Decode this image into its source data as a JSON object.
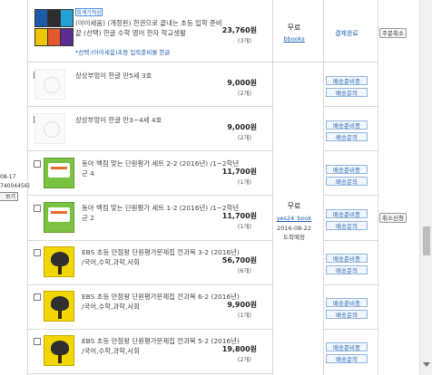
{
  "left_column": {
    "date_fragment": "08-17",
    "order_fragment": "74004456)",
    "button_fragment": "보기"
  },
  "products": [
    {
      "badge": "회계기혁상",
      "title": "(아이세움) (개정판) 한권으로 끝내는 초등 입학 준비 끝 (선택) 한글 수학 영어 한자 학교생활",
      "option": "*선택:(아이세움)초등 입학준비물 한글",
      "price": "23,760원",
      "qty": "(3개)"
    },
    {
      "title": "상상부엉이 한글 만5세 3호",
      "price": "9,000원",
      "qty": "(2개)"
    },
    {
      "title": "상상부엉이 한글 만3~4세 4호",
      "price": "9,000원",
      "qty": "(2개)"
    },
    {
      "title": "동아 백점 맞는 단원평가 세트 2-2 (2016년) /1~2학년군 4",
      "price": "11,700원",
      "qty": "(1개)"
    },
    {
      "title": "동아 백점 맞는 단원평가 세트 1-2 (2016년) /1~2학년군 2",
      "price": "11,700원",
      "qty": "(1개)"
    },
    {
      "title": "EBS 초등 만점왕 단원평가문제집 전과목 3-2 (2016년) /국어,수학,과학,사회",
      "price": "56,700원",
      "qty": "(6개)"
    },
    {
      "title": "EBS 초등 만점왕 단원평가문제집 전과목 6-2 (2016년) /국어,수학,과학,사회",
      "price": "9,900원",
      "qty": "(1개)"
    },
    {
      "title": "EBS 초등 만점왕 단원평가문제집 전과목 5-2 (2016년) /국어,수학,과학,사회",
      "price": "19,800원",
      "qty": "(2개)"
    }
  ],
  "shipping_top": {
    "free": "무료",
    "company": "bbooks"
  },
  "shipping_group": {
    "free": "무료",
    "company": "yes24_book",
    "date": "2016-08-22",
    "note": "도착예정"
  },
  "status": {
    "done": "결제완료",
    "ready": "배송준비중",
    "inquiry": "배송문의"
  },
  "right_buttons": {
    "order_cancel": "주문취소",
    "cancel_request": "취소신청"
  }
}
